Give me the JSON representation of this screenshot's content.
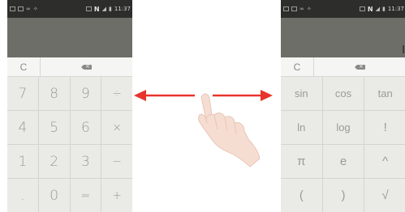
{
  "left_phone": {
    "status": {
      "time": "11:37",
      "nfc": "N"
    },
    "clear_label": "C",
    "keys": [
      "7",
      "8",
      "9",
      "÷",
      "4",
      "5",
      "6",
      "×",
      "1",
      "2",
      "3",
      "−",
      ".",
      "0",
      "=",
      "+"
    ]
  },
  "right_phone": {
    "status": {
      "time": "11:37",
      "nfc": "N"
    },
    "clear_label": "C",
    "keys": [
      "sin",
      "cos",
      "tan",
      "ln",
      "log",
      "!",
      "π",
      "e",
      "^",
      "(",
      ")",
      "√"
    ]
  },
  "colors": {
    "arrow": "#e8342c",
    "hand": "#f6ddd2"
  },
  "icons": [
    "backspace-icon",
    "swipe-hand-icon",
    "double-arrow-icon"
  ]
}
